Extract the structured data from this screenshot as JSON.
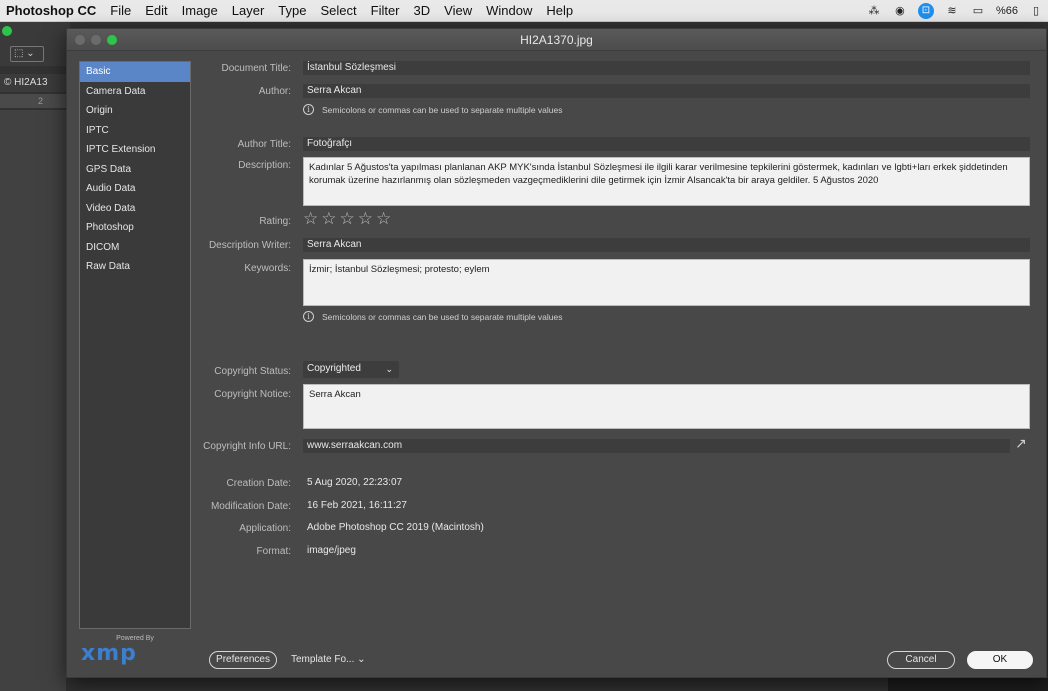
{
  "menubar": {
    "app": "Photoshop CC",
    "items": [
      "File",
      "Edit",
      "Image",
      "Layer",
      "Type",
      "Select",
      "Filter",
      "3D",
      "View",
      "Window",
      "Help"
    ],
    "battery": "%66"
  },
  "ps": {
    "doc_tab": "© HI2A13",
    "ruler_mark": "2"
  },
  "dialog": {
    "title": "HI2A1370.jpg",
    "categories": [
      "Basic",
      "Camera Data",
      "Origin",
      "IPTC",
      "IPTC Extension",
      "GPS Data",
      "Audio Data",
      "Video Data",
      "Photoshop",
      "DICOM",
      "Raw Data"
    ],
    "active_category": "Basic",
    "powered_by": "Powered By",
    "xmp_logo": "xmp",
    "fields": {
      "document_title_label": "Document Title:",
      "document_title": "İstanbul Sözleşmesi",
      "author_label": "Author:",
      "author": "Serra Akcan",
      "author_hint": "Semicolons or commas can be used to separate multiple values",
      "author_title_label": "Author Title:",
      "author_title": "Fotoğrafçı",
      "description_label": "Description:",
      "description": "Kadınlar 5 Ağustos'ta yapılması planlanan AKP MYK'sında İstanbul Sözleşmesi ile ilgili karar verilmesine tepkilerini göstermek, kadınları ve lgbti+ları erkek şiddetinden korumak üzerine hazırlanmış olan sözleşmeden vazgeçmediklerini dile getirmek için İzmir Alsancak'ta bir araya geldiler. 5 Ağustos 2020",
      "rating_label": "Rating:",
      "rating": 0,
      "description_writer_label": "Description Writer:",
      "description_writer": "Serra Akcan",
      "keywords_label": "Keywords:",
      "keywords": "İzmir; İstanbul Sözleşmesi; protesto; eylem",
      "keywords_hint": "Semicolons or commas can be used to separate multiple values",
      "copyright_status_label": "Copyright Status:",
      "copyright_status": "Copyrighted",
      "copyright_notice_label": "Copyright Notice:",
      "copyright_notice": "Serra Akcan",
      "copyright_url_label": "Copyright Info URL:",
      "copyright_url": "www.serraakcan.com",
      "creation_date_label": "Creation Date:",
      "creation_date": "5 Aug 2020, 22:23:07",
      "modification_date_label": "Modification Date:",
      "modification_date": "16 Feb 2021, 16:11:27",
      "application_label": "Application:",
      "application": "Adobe Photoshop CC 2019 (Macintosh)",
      "format_label": "Format:",
      "format": "image/jpeg"
    },
    "buttons": {
      "preferences": "Preferences",
      "template": "Template Fo...",
      "cancel": "Cancel",
      "ok": "OK"
    }
  }
}
